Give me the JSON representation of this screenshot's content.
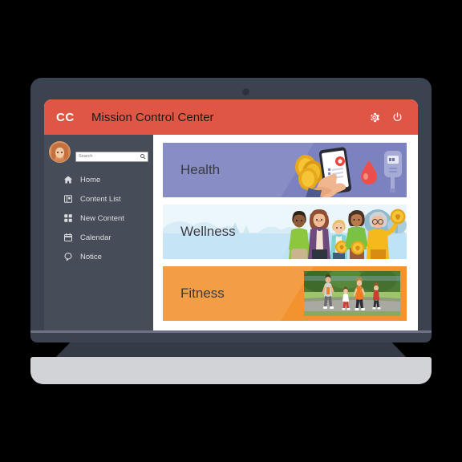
{
  "device": {
    "type": "laptop-mockup",
    "background_color": "#000000",
    "bezel_color": "#3c4350",
    "base_color": "#d2d3d6"
  },
  "app": {
    "logo_text": "CC",
    "title": "Mission Control Center",
    "header_color": "#df5744",
    "header_actions": [
      {
        "name": "settings-icon",
        "label": "Settings"
      },
      {
        "name": "power-icon",
        "label": "Power"
      }
    ]
  },
  "sidebar": {
    "background_color": "#474d58",
    "avatar": {
      "name": "user-avatar",
      "alt": "User profile picture"
    },
    "search": {
      "placeholder": "Search",
      "value": ""
    },
    "items": [
      {
        "label": "Home",
        "icon": "home-icon"
      },
      {
        "label": "Content List",
        "icon": "book-icon"
      },
      {
        "label": "New Content",
        "icon": "grid-icon"
      },
      {
        "label": "Calendar",
        "icon": "calendar-icon"
      },
      {
        "label": "Notice",
        "icon": "speech-bubble-icon"
      }
    ]
  },
  "main": {
    "cards": [
      {
        "title": "Health",
        "background_color": "#7b82bf",
        "art": "hand-holding-smartphone-with-blood-drop-and-glucometer"
      },
      {
        "title": "Wellness",
        "background_color": "#c9e6f5",
        "art": "group-of-people-holding-gold-medals-in-landscape"
      },
      {
        "title": "Fitness",
        "background_color": "#f2932f",
        "art": "photo-of-family-jogging-outdoors"
      }
    ]
  }
}
